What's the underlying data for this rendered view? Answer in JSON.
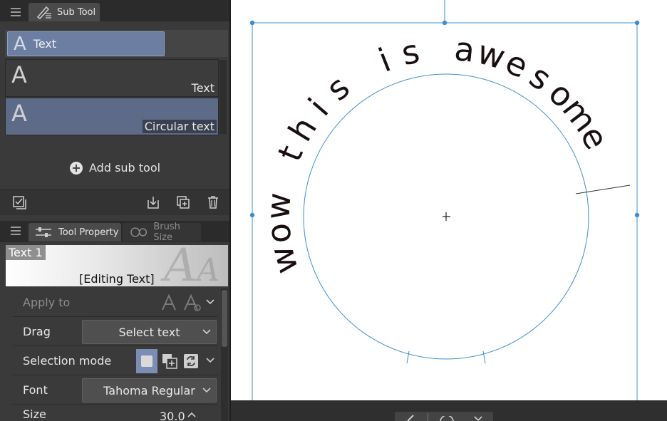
{
  "subtool_panel": {
    "tab_label": "Sub Tool",
    "group_label": "Text",
    "group_icon_glyph": "A",
    "items": [
      {
        "glyph": "A",
        "label": "Text",
        "selected": false
      },
      {
        "glyph": "A",
        "label": "Circular text",
        "selected": true
      }
    ],
    "add_label": "Add sub tool"
  },
  "tool_property": {
    "tab_label": "Tool Property",
    "tab2_label": "Brush Size",
    "preset_name": "Text 1",
    "status": "[Editing Text]",
    "rows": {
      "apply_to": {
        "label": "Apply to"
      },
      "drag": {
        "label": "Drag",
        "value": "Select text"
      },
      "selection_mode": {
        "label": "Selection mode"
      },
      "font": {
        "label": "Font",
        "value": "Tahoma Regular"
      },
      "size": {
        "label": "Size",
        "value": "30.0"
      }
    }
  },
  "canvas": {
    "circular_text": "wow this is awesome"
  },
  "colors": {
    "accent": "#6c7fa3",
    "selection_line": "#3a8fd0",
    "panel_bg": "#3a3a3a"
  }
}
